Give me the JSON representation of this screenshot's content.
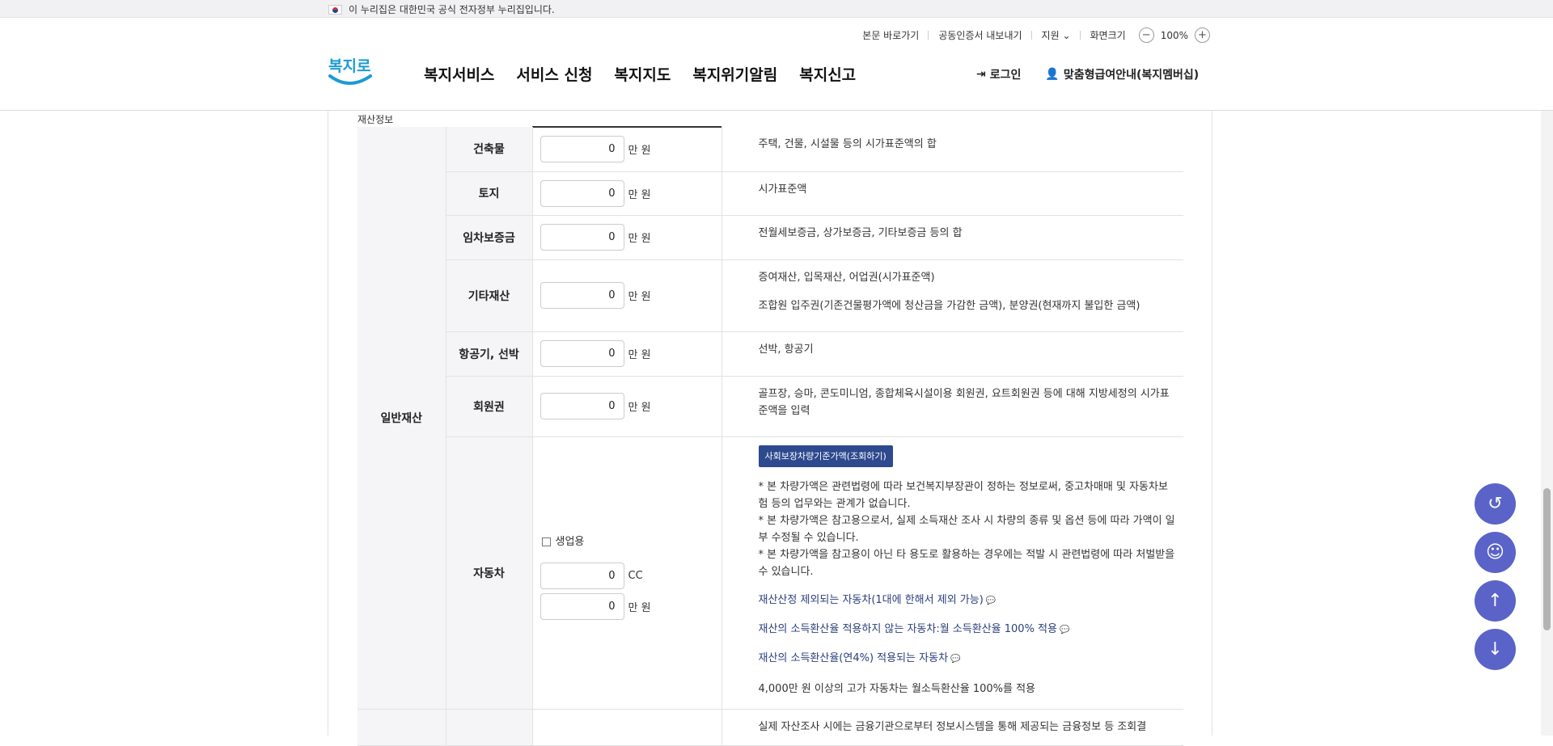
{
  "govbar": {
    "text": "이 누리집은 대한민국 공식 전자정부 누리집입니다."
  },
  "util": {
    "skip": "본문 바로가기",
    "cert": "공동인증서 내보내기",
    "support": "지원",
    "zoom_label": "화면크기",
    "zoom_value": "100%"
  },
  "logo": {
    "text": "복지로"
  },
  "gnb": [
    "복지서비스",
    "서비스 신청",
    "복지지도",
    "복지위기알림",
    "복지신고"
  ],
  "auth": {
    "login": "로그인",
    "membership": "맞춤형급여안내(복지멤버십)"
  },
  "section": {
    "caption": "재산정보",
    "category": "일반재산"
  },
  "unit_won": "만 원",
  "unit_cc": "CC",
  "rows": [
    {
      "label": "건축물",
      "value": "0",
      "desc": [
        "주택, 건물, 시설물 등의 시가표준액의 합"
      ]
    },
    {
      "label": "토지",
      "value": "0",
      "desc": [
        "시가표준액"
      ]
    },
    {
      "label": "임차보증금",
      "value": "0",
      "desc": [
        "전월세보증금, 상가보증금, 기타보증금 등의 합"
      ]
    },
    {
      "label": "기타재산",
      "value": "0",
      "desc": [
        "증여재산, 입목재산, 어업권(시가표준액)",
        "조합원 입주권(기존건물평가액에 청산금을 가감한 금액), 분양권(현재까지 불입한 금액)"
      ]
    },
    {
      "label": "항공기, 선박",
      "value": "0",
      "desc": [
        "선박, 항공기"
      ]
    },
    {
      "label": "회원권",
      "value": "0",
      "desc": [
        "골프장, 승마, 콘도미니엄, 종합체육시설이용 회원권, 요트회원권 등에 대해 지방세정의 시가표준액을 입력"
      ]
    }
  ],
  "car": {
    "label": "자동차",
    "business_label": "생업용",
    "cc_value": "0",
    "won_value": "0",
    "lookup_button": "사회보장차량기준가액(조회하기)",
    "notes": [
      "* 본 차량가액은 관련법령에 따라 보건복지부장관이 정하는 정보로써, 중고차매매 및 자동차보험 등의 업무와는 관계가 없습니다.",
      "* 본 차량가액은 참고용으로서, 실제 소득재산 조사 시 차량의 종류 및 옵션 등에 따라 가액이 일부 수정될 수 있습니다.",
      "* 본 차량가액을 참고용이 아닌 타 용도로 활용하는 경우에는 적발 시 관련법령에 따라 처벌받을 수 있습니다."
    ],
    "links": [
      "재산산정 제외되는 자동차(1대에 한해서 제외 가능)",
      "재산의 소득환산율 적용하지 않는 자동차:월 소득환산율 100% 적용",
      "재산의 소득환산율(연4%) 적용되는 자동차"
    ],
    "footnote": "4,000만 원 이상의 고가 자동차는 월소득환산율 100%를 적용"
  },
  "next_desc": "실제 자산조사 시에는 금융기관으로부터 정보시스템을 통해 제공되는 금융정보 등 조회결"
}
